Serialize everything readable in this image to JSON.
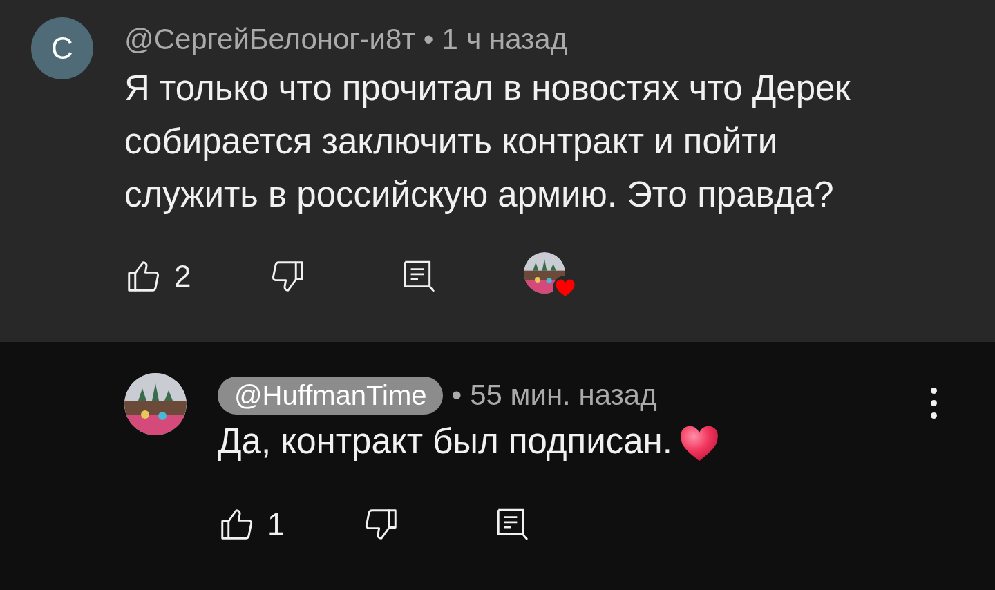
{
  "comments": [
    {
      "avatar_letter": "С",
      "author": "@СергейБелоног-и8т",
      "author_highlighted": false,
      "separator": "•",
      "time": "1 ч назад",
      "text": "Я только что прочитал в новостях что Дерек собирается заключить контракт и пойти служить в российскую армию. Это правда?",
      "likes": "2",
      "hearted": true,
      "has_menu": false,
      "ends_with_heart": false
    },
    {
      "author": "@HuffmanTime",
      "author_highlighted": true,
      "separator": "•",
      "time": "55 мин. назад",
      "text": "Да, контракт был подписан.",
      "likes": "1",
      "hearted": false,
      "has_menu": true,
      "ends_with_heart": true
    }
  ]
}
